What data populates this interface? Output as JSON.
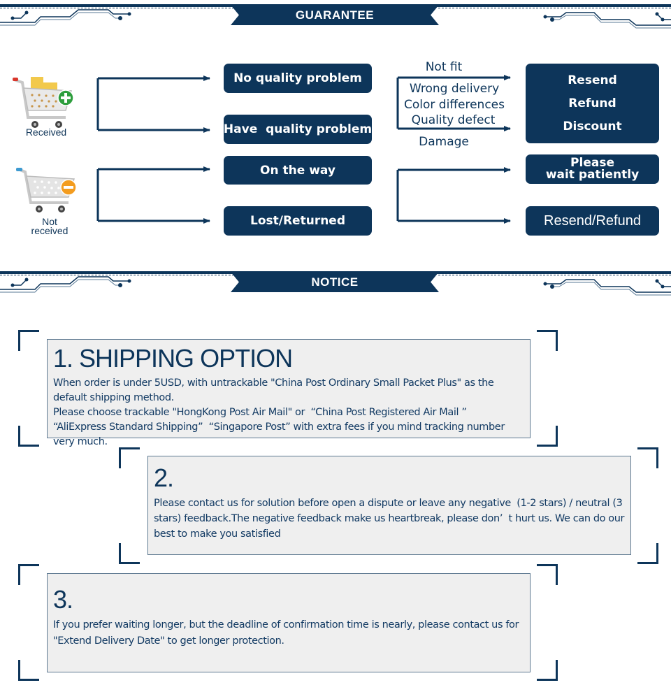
{
  "sections": {
    "guarantee_title": "GUARANTEE",
    "notice_title": "NOTICE"
  },
  "colors": {
    "primary": "#0d355a",
    "card_bg": "#efefef",
    "text": "#123a63"
  },
  "flow": {
    "received": {
      "label": "Received",
      "icon": "cart-plus-icon",
      "outcomes": [
        {
          "label": "No quality problem"
        },
        {
          "label": "Have  quality problem"
        }
      ],
      "reasons": [
        "Not fit",
        "Wrong delivery",
        "Color differences",
        "Quality defect",
        "Damage"
      ],
      "solution_lines": [
        "Resend",
        "Refund",
        "Discount"
      ]
    },
    "not_received": {
      "label_line1": "Not",
      "label_line2": "received",
      "icon": "cart-minus-icon",
      "outcomes": [
        {
          "label": "On the way",
          "result_line1": "Please",
          "result_line2": "wait patiently"
        },
        {
          "label": "Lost/Returned",
          "result": "Resend/Refund"
        }
      ]
    }
  },
  "notices": [
    {
      "title": "1. SHIPPING OPTION",
      "paragraphs": [
        "When order is under 5USD, with untrackable \"China Post Ordinary Small Packet Plus\" as the default shipping  method.",
        "Please choose trackable \"HongKong Post Air Mail\" or  “China Post Registered Air Mail ”  “AliExpress Standard Shipping”  “Singapore Post” with extra fees if you mind tracking number very much."
      ]
    },
    {
      "title": "2.",
      "paragraphs": [
        "Please contact us for solution before open a dispute or leave any negative  (1-2 stars) / neutral (3 stars) feedback.The negative feedback make us heartbreak, please don’  t hurt us. We can do our best to make you satisfied"
      ]
    },
    {
      "title": "3.",
      "paragraphs": [
        "If you prefer waiting longer, but the deadline of confirmation time is nearly, please contact us for \"Extend Delivery Date\" to get longer protection."
      ]
    }
  ]
}
